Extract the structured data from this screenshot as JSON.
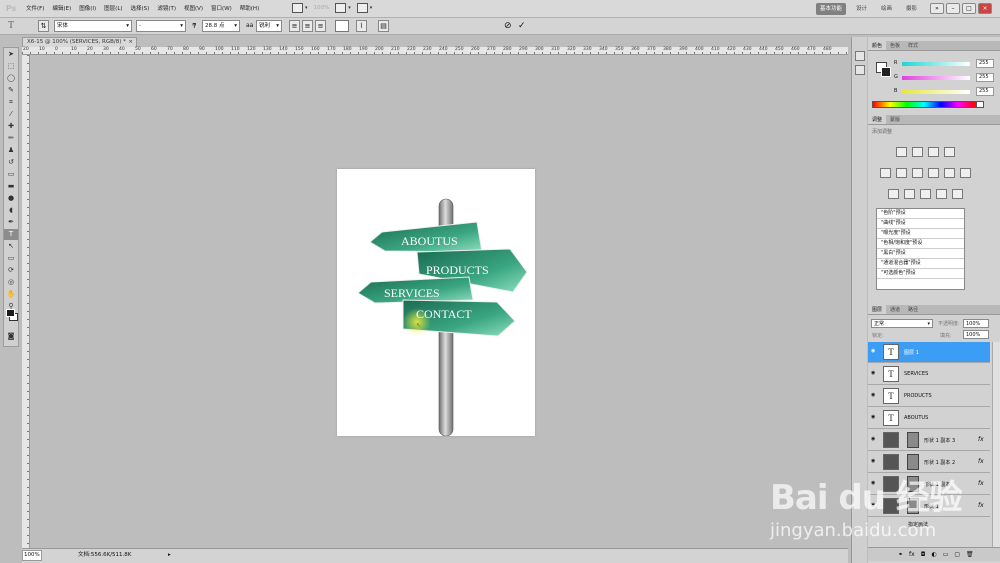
{
  "app": {
    "logo": "Ps"
  },
  "menu": [
    "文件(F)",
    "编辑(E)",
    "图像(I)",
    "图层(L)",
    "选择(S)",
    "滤镜(T)",
    "视图(V)",
    "窗口(W)",
    "帮助(H)"
  ],
  "menubar_tools": {
    "zoom_value": "100%"
  },
  "workspaces": [
    "基本功能",
    "设计",
    "绘画",
    "摄影"
  ],
  "options": {
    "font_family": "宋体",
    "font_style": "-",
    "font_size": "28.8 点",
    "anti_alias": "锐利"
  },
  "document": {
    "tab_title": "X6-15 @ 100% (SERVICES, RGB/8) *",
    "sign_labels": [
      "ABOUTUS",
      "PRODUCTS",
      "SERVICES",
      "CONTACT"
    ],
    "colors": {
      "sign_dark": "#1e7a5e",
      "sign_light": "#7fd6b4",
      "pole": "#8c8c8c"
    }
  },
  "rulers": {
    "top": [
      "20",
      "10",
      "0",
      "10",
      "20",
      "30",
      "40",
      "50",
      "60",
      "70",
      "80",
      "90",
      "100",
      "110",
      "120",
      "130",
      "140",
      "150",
      "160",
      "170",
      "180",
      "190",
      "200",
      "210",
      "220",
      "230",
      "240",
      "250",
      "260",
      "270",
      "280",
      "290",
      "300",
      "310",
      "320",
      "330",
      "340",
      "350",
      "360",
      "370",
      "380",
      "390",
      "400",
      "410",
      "420",
      "430",
      "440",
      "450",
      "460",
      "470",
      "480"
    ]
  },
  "status": {
    "zoom": "100%",
    "doc_size": "文档:556.6K/511.8K"
  },
  "color_panel": {
    "tabs": [
      "颜色",
      "色板",
      "样式"
    ],
    "channels": [
      {
        "label": "R",
        "value": "255"
      },
      {
        "label": "G",
        "value": "255"
      },
      {
        "label": "B",
        "value": "255"
      }
    ]
  },
  "adjust_panel": {
    "tabs": [
      "调整",
      "蒙版"
    ],
    "hint": "添加调整",
    "presets": [
      "\"色阶\"预设",
      "\"曲线\"预设",
      "\"曝光度\"预设",
      "\"色相/饱和度\"预设",
      "\"黑白\"预设",
      "\"通道混合器\"预设",
      "\"可选颜色\"预设"
    ]
  },
  "layers_panel": {
    "tabs": [
      "图层",
      "通道",
      "路径"
    ],
    "blend_mode": "正常",
    "opacity_label": "不透明度:",
    "opacity": "100%",
    "lock_label": "锁定:",
    "fill_label": "填充:",
    "fill": "100%",
    "layers": [
      {
        "name": "图层 1",
        "kind": "text",
        "selected": true
      },
      {
        "name": "SERVICES",
        "kind": "text"
      },
      {
        "name": "PRODUCTS",
        "kind": "text"
      },
      {
        "name": "ABOUTUS",
        "kind": "text"
      },
      {
        "name": "形状 1 副本 3",
        "kind": "shape",
        "fx": "fx"
      },
      {
        "name": "形状 1 副本 2",
        "kind": "shape",
        "fx": "fx"
      },
      {
        "name": "形状 1 副本",
        "kind": "shape",
        "fx": "fx"
      },
      {
        "name": "形状 1",
        "kind": "shape",
        "fx": "fx"
      }
    ],
    "partial_row": "指定画法"
  },
  "watermark": {
    "main": "Bai du 经验",
    "sub": "jingyan.baidu.com"
  }
}
